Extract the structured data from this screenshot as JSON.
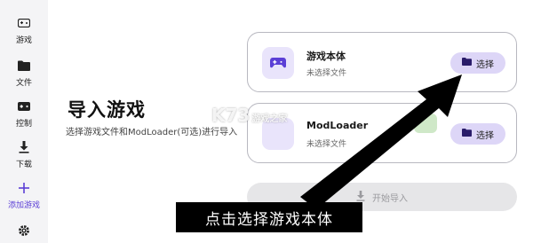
{
  "sidebar": {
    "items": [
      {
        "label": "游戏",
        "icon": "gamepad-icon"
      },
      {
        "label": "文件",
        "icon": "folder-icon"
      },
      {
        "label": "控制",
        "icon": "controller-icon"
      },
      {
        "label": "下载",
        "icon": "download-icon"
      },
      {
        "label": "添加游戏",
        "icon": "plus-icon"
      }
    ],
    "settings_icon": "gear-icon"
  },
  "main": {
    "title": "导入游戏",
    "description": "选择游戏文件和ModLoader(可选)进行导入",
    "cards": [
      {
        "title": "游戏本体",
        "subtitle": "未选择文件",
        "button": "选择"
      },
      {
        "title": "ModLoader",
        "subtitle": "未选择文件",
        "button": "选择"
      }
    ],
    "start_button": "开始导入"
  },
  "watermark": {
    "text": "K73",
    "sub": "游戏之家"
  },
  "caption": "点击选择游戏本体",
  "colors": {
    "accent": "#5b3fd6",
    "sidebar": "#f4f4f6",
    "pick_button": "#ddd6f7",
    "thumb": "#e9e4fb"
  }
}
